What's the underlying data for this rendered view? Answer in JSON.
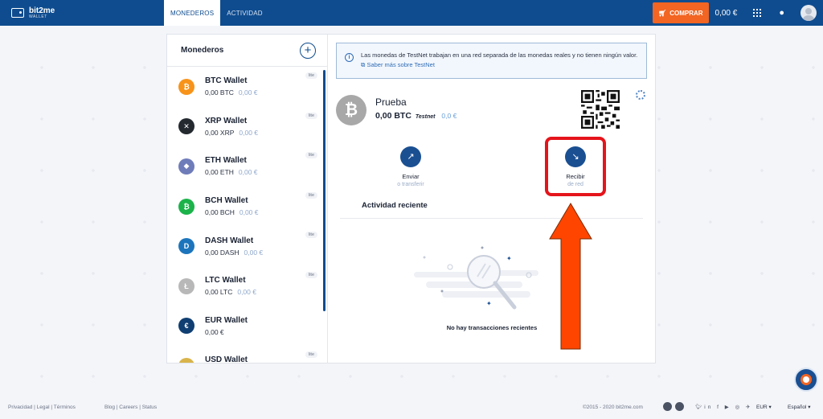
{
  "header": {
    "logo_top": "bit2me",
    "logo_bottom": "WALLET",
    "tabs": [
      {
        "label": "MONEDEROS",
        "active": true
      },
      {
        "label": "ACTIVIDAD",
        "active": false
      }
    ],
    "buy_label": "COMPRAR",
    "balance": "0,00 €"
  },
  "sidebar": {
    "title": "Monederos",
    "add_icon": "plus-icon",
    "wallets": [
      {
        "name": "BTC Wallet",
        "balance": "0,00 BTC",
        "fiat": "0,00 €",
        "badge": "lite",
        "color": "#f7931a",
        "glyph": "₿"
      },
      {
        "name": "XRP Wallet",
        "balance": "0,00 XRP",
        "fiat": "0,00 €",
        "badge": "lite",
        "color": "#23292f",
        "glyph": "✕"
      },
      {
        "name": "ETH Wallet",
        "balance": "0,00 ETH",
        "fiat": "0,00 €",
        "badge": "lite",
        "color": "#6f7cba",
        "glyph": "◆"
      },
      {
        "name": "BCH Wallet",
        "balance": "0,00 BCH",
        "fiat": "0,00 €",
        "badge": "lite",
        "color": "#1bb34a",
        "glyph": "₿"
      },
      {
        "name": "DASH Wallet",
        "balance": "0,00 DASH",
        "fiat": "0,00 €",
        "badge": "lite",
        "color": "#1c75bc",
        "glyph": "D"
      },
      {
        "name": "LTC Wallet",
        "balance": "0,00 LTC",
        "fiat": "0,00 €",
        "badge": "lite",
        "color": "#b8b8b8",
        "glyph": "Ł"
      },
      {
        "name": "EUR Wallet",
        "balance": "0,00 €",
        "fiat": "",
        "badge": "",
        "color": "#0f3e72",
        "glyph": "€"
      },
      {
        "name": "USD Wallet",
        "balance": "",
        "fiat": "",
        "badge": "lite",
        "color": "#d9b44a",
        "glyph": "$"
      }
    ]
  },
  "info": {
    "text": "Las monedas de TestNet trabajan en una red separada de las monedas reales y no tienen ningún valor.",
    "link": "Saber más sobre TestNet"
  },
  "asset": {
    "name": "Prueba",
    "balance": "0,00 BTC",
    "network": "Testnet",
    "fiat": "0,0 €"
  },
  "actions": {
    "send_label": "Enviar",
    "send_sub": "o transferir",
    "receive_label": "Recibir",
    "receive_sub": "de red"
  },
  "recent": {
    "title": "Actividad reciente",
    "empty": "No hay transacciones recientes"
  },
  "footer": {
    "left": "Privacidad | Legal | Términos",
    "middle": "Blog | Careers | Status",
    "copyright": "©2015 - 2020 bit2me.com",
    "currency": "EUR ▾",
    "language": "Español ▾"
  },
  "colors": {
    "brand": "#0f4c8f",
    "buy": "#f26522",
    "highlight": "#e5141b",
    "arrow": "#ff4500"
  }
}
